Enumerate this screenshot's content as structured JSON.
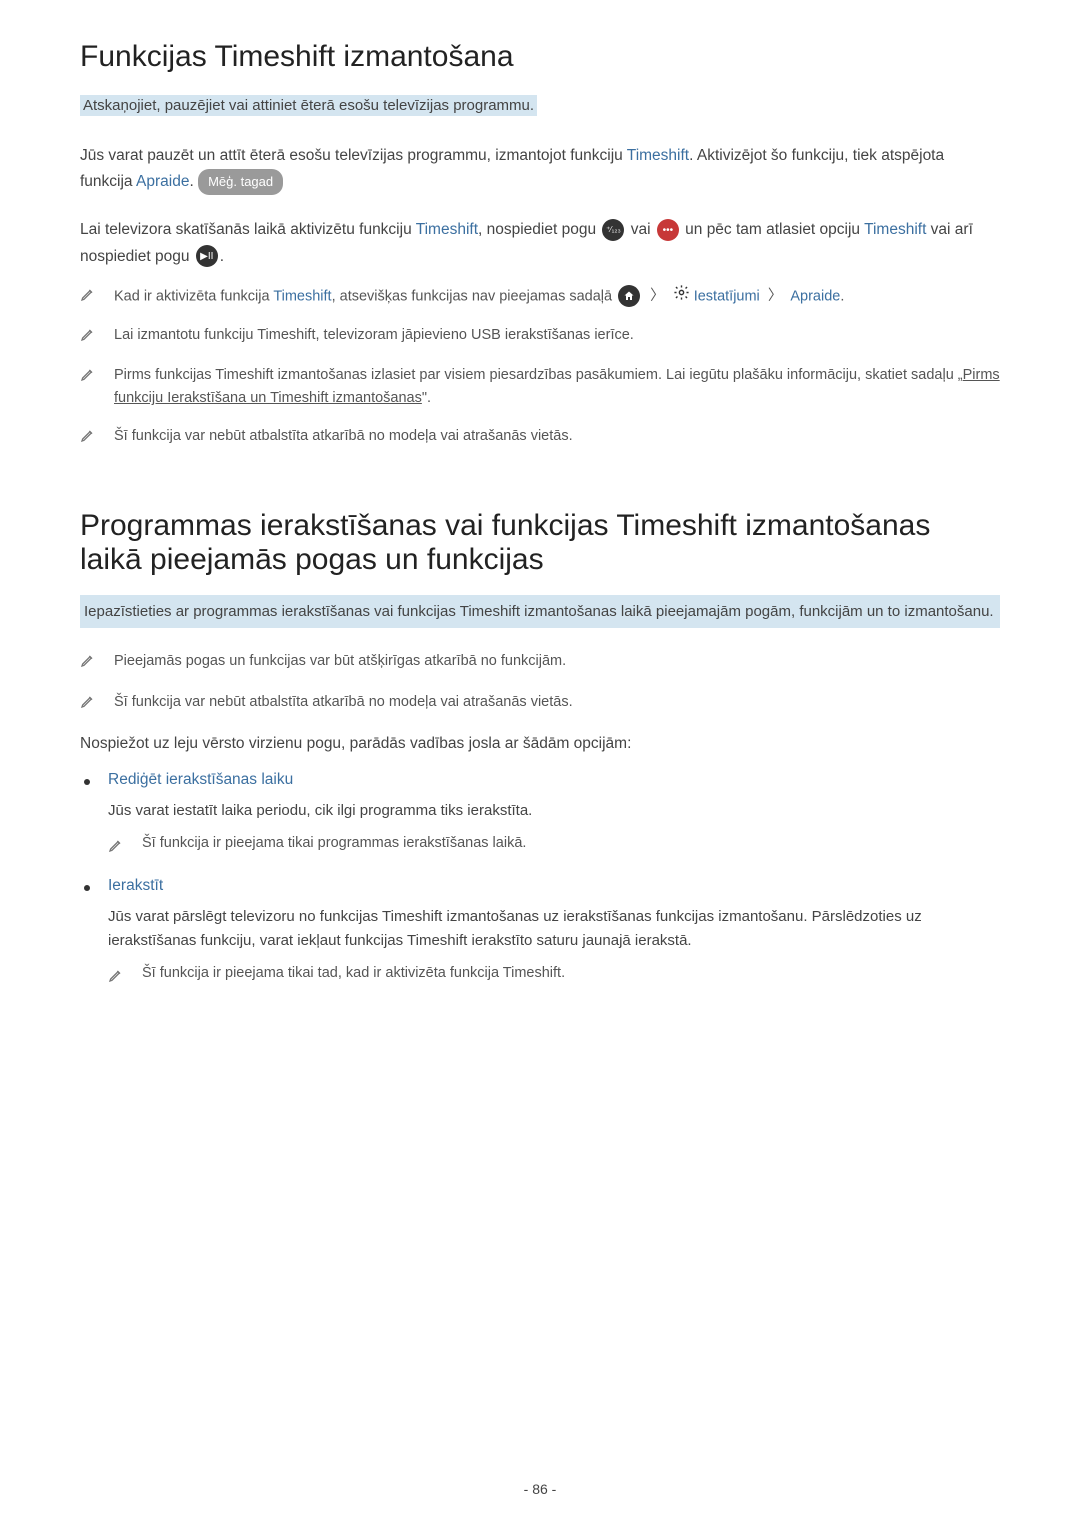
{
  "section1": {
    "heading": "Funkcijas Timeshift izmantošana",
    "highlight": "Atskaņojiet, pauzējiet vai attiniet ēterā esošu televīzijas programmu.",
    "para1_a": "Jūs varat pauzēt un attīt ēterā esošu televīzijas programmu, izmantojot funkciju ",
    "para1_link1": "Timeshift",
    "para1_b": ". Aktivizējot šo funkciju, tiek atspējota funkcija ",
    "para1_link2": "Apraide",
    "para1_c": ". ",
    "try_now": "Mēģ. tagad",
    "para2_a": "Lai televizora skatīšanās laikā aktivizētu funkciju ",
    "para2_link1": "Timeshift",
    "para2_b": ", nospiediet pogu ",
    "para2_c": " vai ",
    "para2_d": " un pēc tam atlasiet opciju ",
    "para2_link2": "Timeshift",
    "para2_e": " vai arī nospiediet pogu ",
    "para2_f": ".",
    "notes": [
      {
        "pre": "Kad ir aktivizēta funkcija ",
        "link1": "Timeshift",
        "mid": ", atsevišķas funkcijas nav pieejamas sadaļā ",
        "path_settings": "Iestatījumi",
        "path_broadcast": "Apraide",
        "post": "."
      },
      {
        "text": "Lai izmantotu funkciju Timeshift, televizoram jāpievieno USB ierakstīšanas ierīce."
      },
      {
        "pre": "Pirms funkcijas Timeshift izmantošanas izlasiet par visiem piesardzības pasākumiem. Lai iegūtu plašāku informāciju, skatiet sadaļu „",
        "linktext": "Pirms funkciju Ierakstīšana un Timeshift izmantošanas",
        "post": "\"."
      },
      {
        "text": "Šī funkcija var nebūt atbalstīta atkarībā no modeļa vai atrašanās vietās."
      }
    ]
  },
  "section2": {
    "heading": "Programmas ierakstīšanas vai funkcijas Timeshift izmantošanas laikā pieejamās pogas un funkcijas",
    "highlight": "Iepazīstieties ar programmas ierakstīšanas vai funkcijas Timeshift izmantošanas laikā pieejamajām pogām, funkcijām un to izmantošanu.",
    "notes": [
      {
        "text": "Pieejamās pogas un funkcijas var būt atšķirīgas atkarībā no funkcijām."
      },
      {
        "text": "Šī funkcija var nebūt atbalstīta atkarībā no modeļa vai atrašanās vietās."
      }
    ],
    "body": "Nospiežot uz leju vērsto virzienu pogu, parādās vadības josla ar šādām opcijām:",
    "items": [
      {
        "title": "Rediģēt ierakstīšanas laiku",
        "desc": "Jūs varat iestatīt laika periodu, cik ilgi programma tiks ierakstīta.",
        "note": "Šī funkcija ir pieejama tikai programmas ierakstīšanas laikā."
      },
      {
        "title": "Ierakstīt",
        "desc": "Jūs varat pārslēgt televizoru no funkcijas Timeshift izmantošanas uz ierakstīšanas funkcijas izmantošanu. Pārslēdzoties uz ierakstīšanas funkciju, varat iekļaut funkcijas Timeshift ierakstīto saturu jaunajā ierakstā.",
        "note": "Šī funkcija ir pieejama tikai tad, kad ir aktivizēta funkcija Timeshift."
      }
    ]
  },
  "page": "- 86 -"
}
